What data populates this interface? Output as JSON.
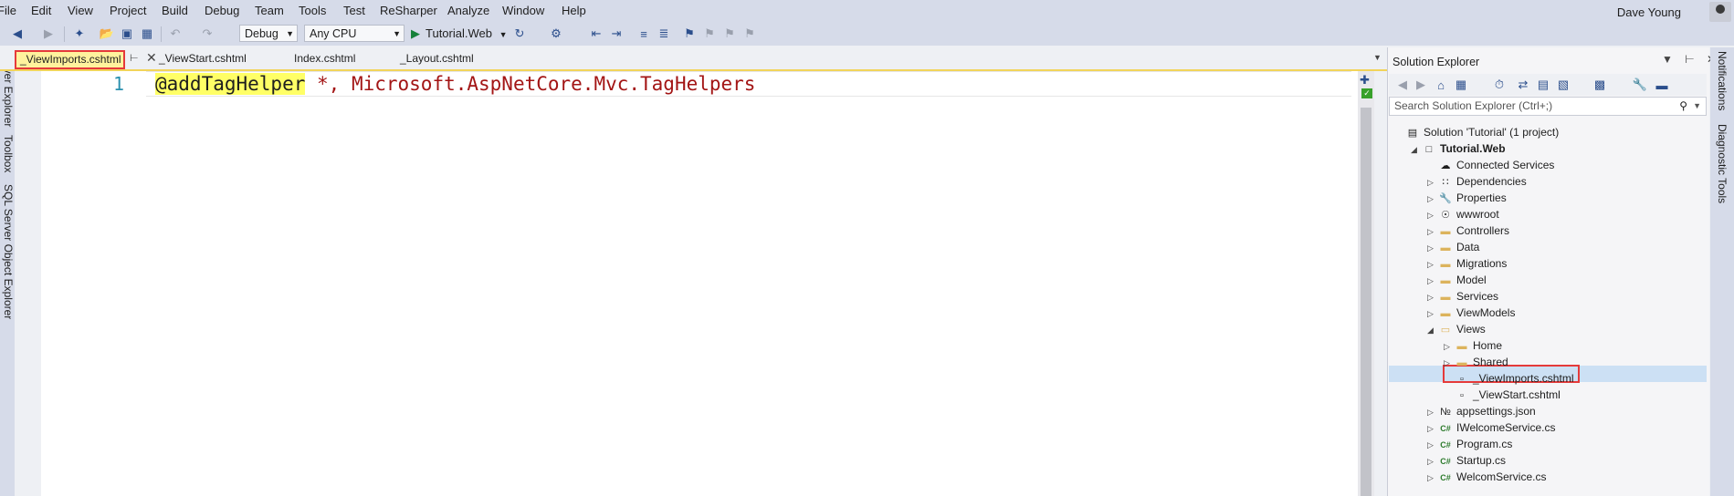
{
  "menu": [
    "File",
    "Edit",
    "View",
    "Project",
    "Build",
    "Debug",
    "Team",
    "Tools",
    "Test",
    "ReSharper",
    "Analyze",
    "Window",
    "Help"
  ],
  "user": {
    "name": "Dave Young"
  },
  "toolbar": {
    "config": "Debug",
    "platform": "Any CPU",
    "run_target": "Tutorial.Web"
  },
  "tabs": {
    "active": "_ViewImports.cshtml",
    "others": [
      "_ViewStart.cshtml",
      "Index.cshtml",
      "_Layout.cshtml"
    ]
  },
  "left_strip": [
    "Server Explorer",
    "Toolbox",
    "SQL Server Object Explorer"
  ],
  "editor": {
    "line_number": "1",
    "highlight": "@addTagHelper",
    "rest": " *, Microsoft.AspNetCore.Mvc.TagHelpers"
  },
  "solution_explorer": {
    "title": "Solution Explorer",
    "search_placeholder": "Search Solution Explorer (Ctrl+;)",
    "items": [
      {
        "label": "Solution 'Tutorial' (1 project)",
        "icon": "solution-icon",
        "level": 0,
        "arrow": ""
      },
      {
        "label": "Tutorial.Web",
        "icon": "project-icon",
        "level": 1,
        "arrow": "expanded",
        "bold": true
      },
      {
        "label": "Connected Services",
        "icon": "cloud-icon",
        "level": 2,
        "arrow": ""
      },
      {
        "label": "Dependencies",
        "icon": "dependencies-icon",
        "level": 2,
        "arrow": "collapsed"
      },
      {
        "label": "Properties",
        "icon": "wrench-icon",
        "level": 2,
        "arrow": "collapsed"
      },
      {
        "label": "wwwroot",
        "icon": "globe-icon",
        "level": 2,
        "arrow": "collapsed"
      },
      {
        "label": "Controllers",
        "icon": "folder-icon",
        "level": 2,
        "arrow": "collapsed"
      },
      {
        "label": "Data",
        "icon": "folder-icon",
        "level": 2,
        "arrow": "collapsed"
      },
      {
        "label": "Migrations",
        "icon": "folder-icon",
        "level": 2,
        "arrow": "collapsed"
      },
      {
        "label": "Model",
        "icon": "folder-icon",
        "level": 2,
        "arrow": "collapsed"
      },
      {
        "label": "Services",
        "icon": "folder-icon",
        "level": 2,
        "arrow": "collapsed"
      },
      {
        "label": "ViewModels",
        "icon": "folder-icon",
        "level": 2,
        "arrow": "collapsed"
      },
      {
        "label": "Views",
        "icon": "folder-open-icon",
        "level": 2,
        "arrow": "expanded"
      },
      {
        "label": "Home",
        "icon": "folder-icon",
        "level": 3,
        "arrow": "collapsed"
      },
      {
        "label": "Shared",
        "icon": "folder-icon",
        "level": 3,
        "arrow": "collapsed"
      },
      {
        "label": "_ViewImports.cshtml",
        "icon": "razor-file-icon",
        "level": 3,
        "arrow": "",
        "selected": true
      },
      {
        "label": "_ViewStart.cshtml",
        "icon": "razor-file-icon",
        "level": 3,
        "arrow": ""
      },
      {
        "label": "appsettings.json",
        "icon": "json-file-icon",
        "level": 2,
        "arrow": "collapsed"
      },
      {
        "label": "IWelcomeService.cs",
        "icon": "csharp-file-icon",
        "level": 2,
        "arrow": "collapsed"
      },
      {
        "label": "Program.cs",
        "icon": "csharp-file-icon",
        "level": 2,
        "arrow": "collapsed"
      },
      {
        "label": "Startup.cs",
        "icon": "csharp-file-icon",
        "level": 2,
        "arrow": "collapsed"
      },
      {
        "label": "WelcomService.cs",
        "icon": "csharp-file-icon",
        "level": 2,
        "arrow": "collapsed"
      }
    ]
  },
  "right_strip": [
    "Notifications",
    "Diagnostic Tools"
  ],
  "colors": {
    "accent": "#e53a3a",
    "highlight": "#ffff66",
    "tab_active": "#fff29d",
    "selection": "#cce0f4"
  }
}
